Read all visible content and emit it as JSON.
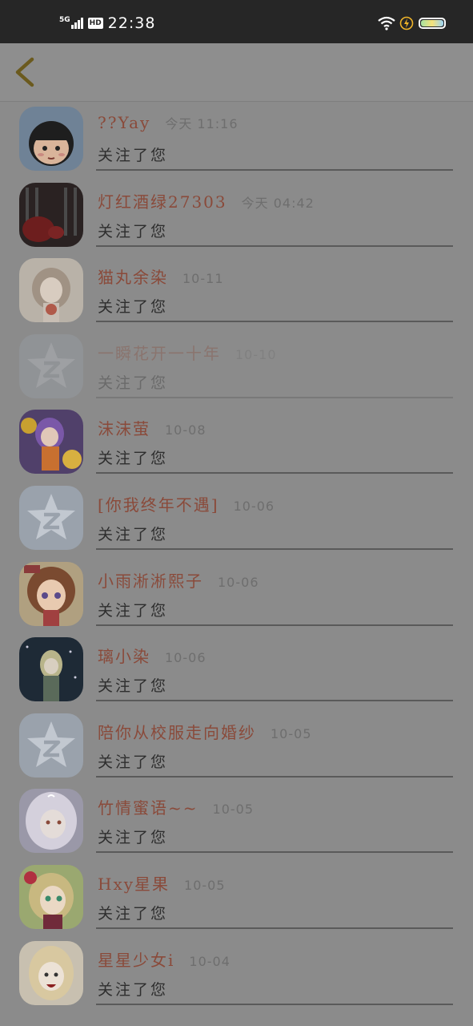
{
  "status_bar": {
    "network": "5G",
    "hd": "HD",
    "time": "22:38"
  },
  "header": {
    "back_icon": "chevron-left-icon",
    "accent": "#6b5a1e"
  },
  "items": [
    {
      "name": "??Yay",
      "time": "今天 11:16",
      "action": "关注了您",
      "avatar": "cartoon"
    },
    {
      "name": "灯红酒绿27303",
      "time": "今天 04:42",
      "action": "关注了您",
      "avatar": "dark-red"
    },
    {
      "name": "猫丸余染",
      "time": "10-11",
      "action": "关注了您",
      "avatar": "light-girl"
    },
    {
      "name": "一瞬花开一十年",
      "time": "10-10",
      "action": "关注了您",
      "avatar": "qq-default",
      "faded": true
    },
    {
      "name": "沫沫萤",
      "time": "10-08",
      "action": "关注了您",
      "avatar": "purple-anime"
    },
    {
      "name": "[你我终年不遇]",
      "time": "10-06",
      "action": "关注了您",
      "avatar": "qq-default"
    },
    {
      "name": "小雨淅淅熙子",
      "time": "10-06",
      "action": "关注了您",
      "avatar": "brown-anime"
    },
    {
      "name": "璃小染",
      "time": "10-06",
      "action": "关注了您",
      "avatar": "dark-anime"
    },
    {
      "name": "陪你从校服走向婚纱",
      "time": "10-05",
      "action": "关注了您",
      "avatar": "qq-default"
    },
    {
      "name": "竹情蜜语~~",
      "time": "10-05",
      "action": "关注了您",
      "avatar": "white-anime"
    },
    {
      "name": "Hxy星果",
      "time": "10-05",
      "action": "关注了您",
      "avatar": "green-anime"
    },
    {
      "name": "星星少女i",
      "time": "10-04",
      "action": "关注了您",
      "avatar": "blond-anime"
    }
  ]
}
